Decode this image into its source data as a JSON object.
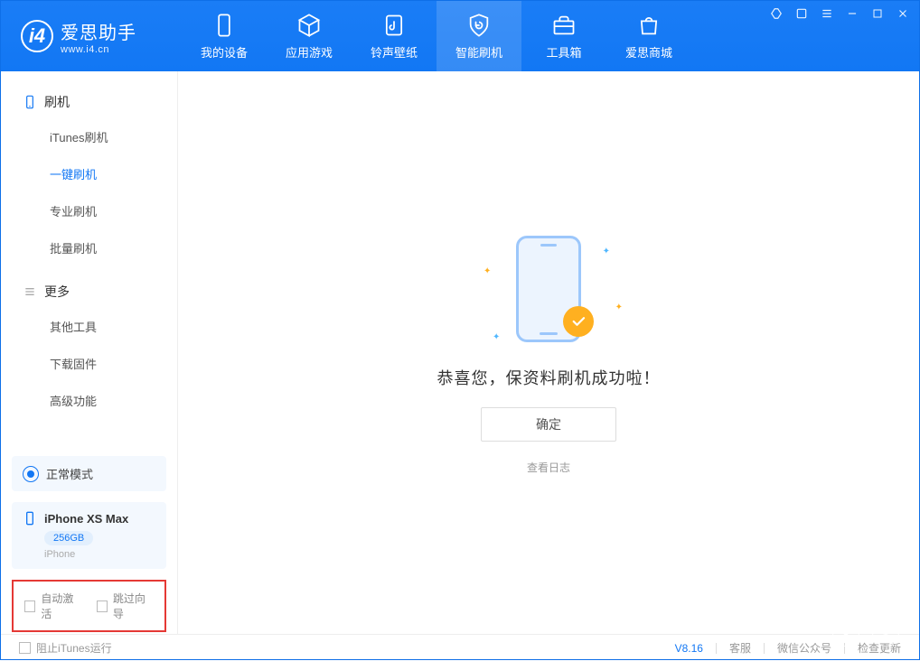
{
  "app": {
    "name_cn": "爱思助手",
    "url": "www.i4.cn"
  },
  "tabs": [
    {
      "label": "我的设备"
    },
    {
      "label": "应用游戏"
    },
    {
      "label": "铃声壁纸"
    },
    {
      "label": "智能刷机"
    },
    {
      "label": "工具箱"
    },
    {
      "label": "爱思商城"
    }
  ],
  "sidebar": {
    "group1_title": "刷机",
    "group1": [
      {
        "label": "iTunes刷机"
      },
      {
        "label": "一键刷机",
        "active": true
      },
      {
        "label": "专业刷机"
      },
      {
        "label": "批量刷机"
      }
    ],
    "group2_title": "更多",
    "group2": [
      {
        "label": "其他工具"
      },
      {
        "label": "下载固件"
      },
      {
        "label": "高级功能"
      }
    ]
  },
  "mode": {
    "label": "正常模式"
  },
  "device": {
    "name": "iPhone XS Max",
    "capacity": "256GB",
    "sub": "iPhone"
  },
  "options": {
    "auto_activate": "自动激活",
    "skip_guide": "跳过向导"
  },
  "main": {
    "success_msg": "恭喜您，保资料刷机成功啦！",
    "ok": "确定",
    "view_log": "查看日志"
  },
  "footer": {
    "block_itunes": "阻止iTunes运行",
    "version": "V8.16",
    "support": "客服",
    "wechat": "微信公众号",
    "update": "检查更新"
  }
}
